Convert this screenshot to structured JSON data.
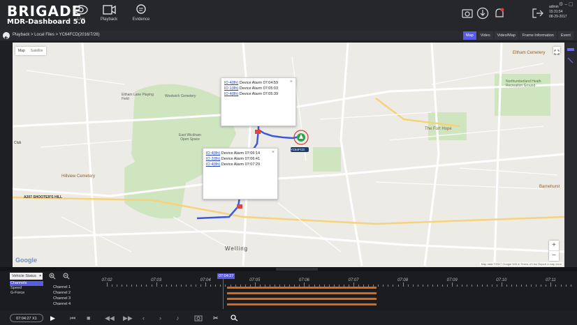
{
  "app": {
    "brand_name": "BRIGADE",
    "brand_sub": "MDR-Dashboard 5.0",
    "nav": [
      {
        "label": "Live",
        "icon": "eye-icon"
      },
      {
        "label": "Playback",
        "icon": "film-icon"
      },
      {
        "label": "Evidence",
        "icon": "chat-icon"
      }
    ],
    "user": {
      "name": "admin",
      "time": "15:31:54",
      "date": "08-29-2017"
    },
    "window_controls": "⚙ ‒ ▢"
  },
  "breadcrumb": "Playback > Local Files > YC64FCD(2016/7/26)",
  "tabs": [
    {
      "label": "Map",
      "active": true
    },
    {
      "label": "Video",
      "active": false
    },
    {
      "label": "Video/Map",
      "active": false
    },
    {
      "label": "Frame Information",
      "active": false
    },
    {
      "label": "Event",
      "active": false
    }
  ],
  "map": {
    "type_buttons": [
      "Map",
      "Satellite"
    ],
    "popups": [
      {
        "rows": [
          {
            "code": "IO 4(8h)",
            "text": "Device Alarm 07:04:59"
          },
          {
            "code": "IO 1(8h)",
            "text": "Device Alarm 07:05:03"
          },
          {
            "code": "IO 4(8h)",
            "text": "Device Alarm 07:05:39"
          }
        ]
      },
      {
        "rows": [
          {
            "code": "IO 4(8h)",
            "text": "Device Alarm 07:06:14"
          },
          {
            "code": "IO 2(8h)",
            "text": "Device Alarm 07:06:41"
          },
          {
            "code": "IO 4(8h)",
            "text": "Device Alarm 07:07:29"
          }
        ]
      }
    ],
    "vehicle_label": "YC64FCD",
    "place_labels": {
      "cemetery1": "Woolwich Cemetery",
      "playing": "Eltham Lane Playing Field",
      "openspace": "East Wickham Open Space",
      "hillview": "Hillview Cemetery",
      "shooters": "A207   SHOOTER'S HILL",
      "welling": "Welling",
      "eltham_cem": "Eltham Cemetery",
      "rugby": "Northumberland Heath Recreation Ground",
      "falcon": "The Fort Hope",
      "club": "Club",
      "bexley": "Barnehurst"
    },
    "google": "Google",
    "footer": "Map data ©2017 Google   500 m   Terms of Use   Report a map error",
    "zoom_in": "+",
    "zoom_out": "−"
  },
  "timeline": {
    "status_select": "Vehicle Status",
    "categories": [
      {
        "label": "Channels",
        "selected": true
      },
      {
        "label": "Speed",
        "selected": false
      },
      {
        "label": "G-Force",
        "selected": false
      }
    ],
    "tick_labels": [
      "07:02",
      "07:03",
      "07:04",
      "07:05",
      "07:06",
      "07:07",
      "07:08",
      "07:09",
      "07:10",
      "07:11"
    ],
    "cursor_time": "07:04:27",
    "channels": [
      "Channel 1",
      "Channel 2",
      "Channel 3",
      "Channel 4"
    ]
  },
  "playback": {
    "current_time": "07:04:27",
    "speed": "X1"
  }
}
